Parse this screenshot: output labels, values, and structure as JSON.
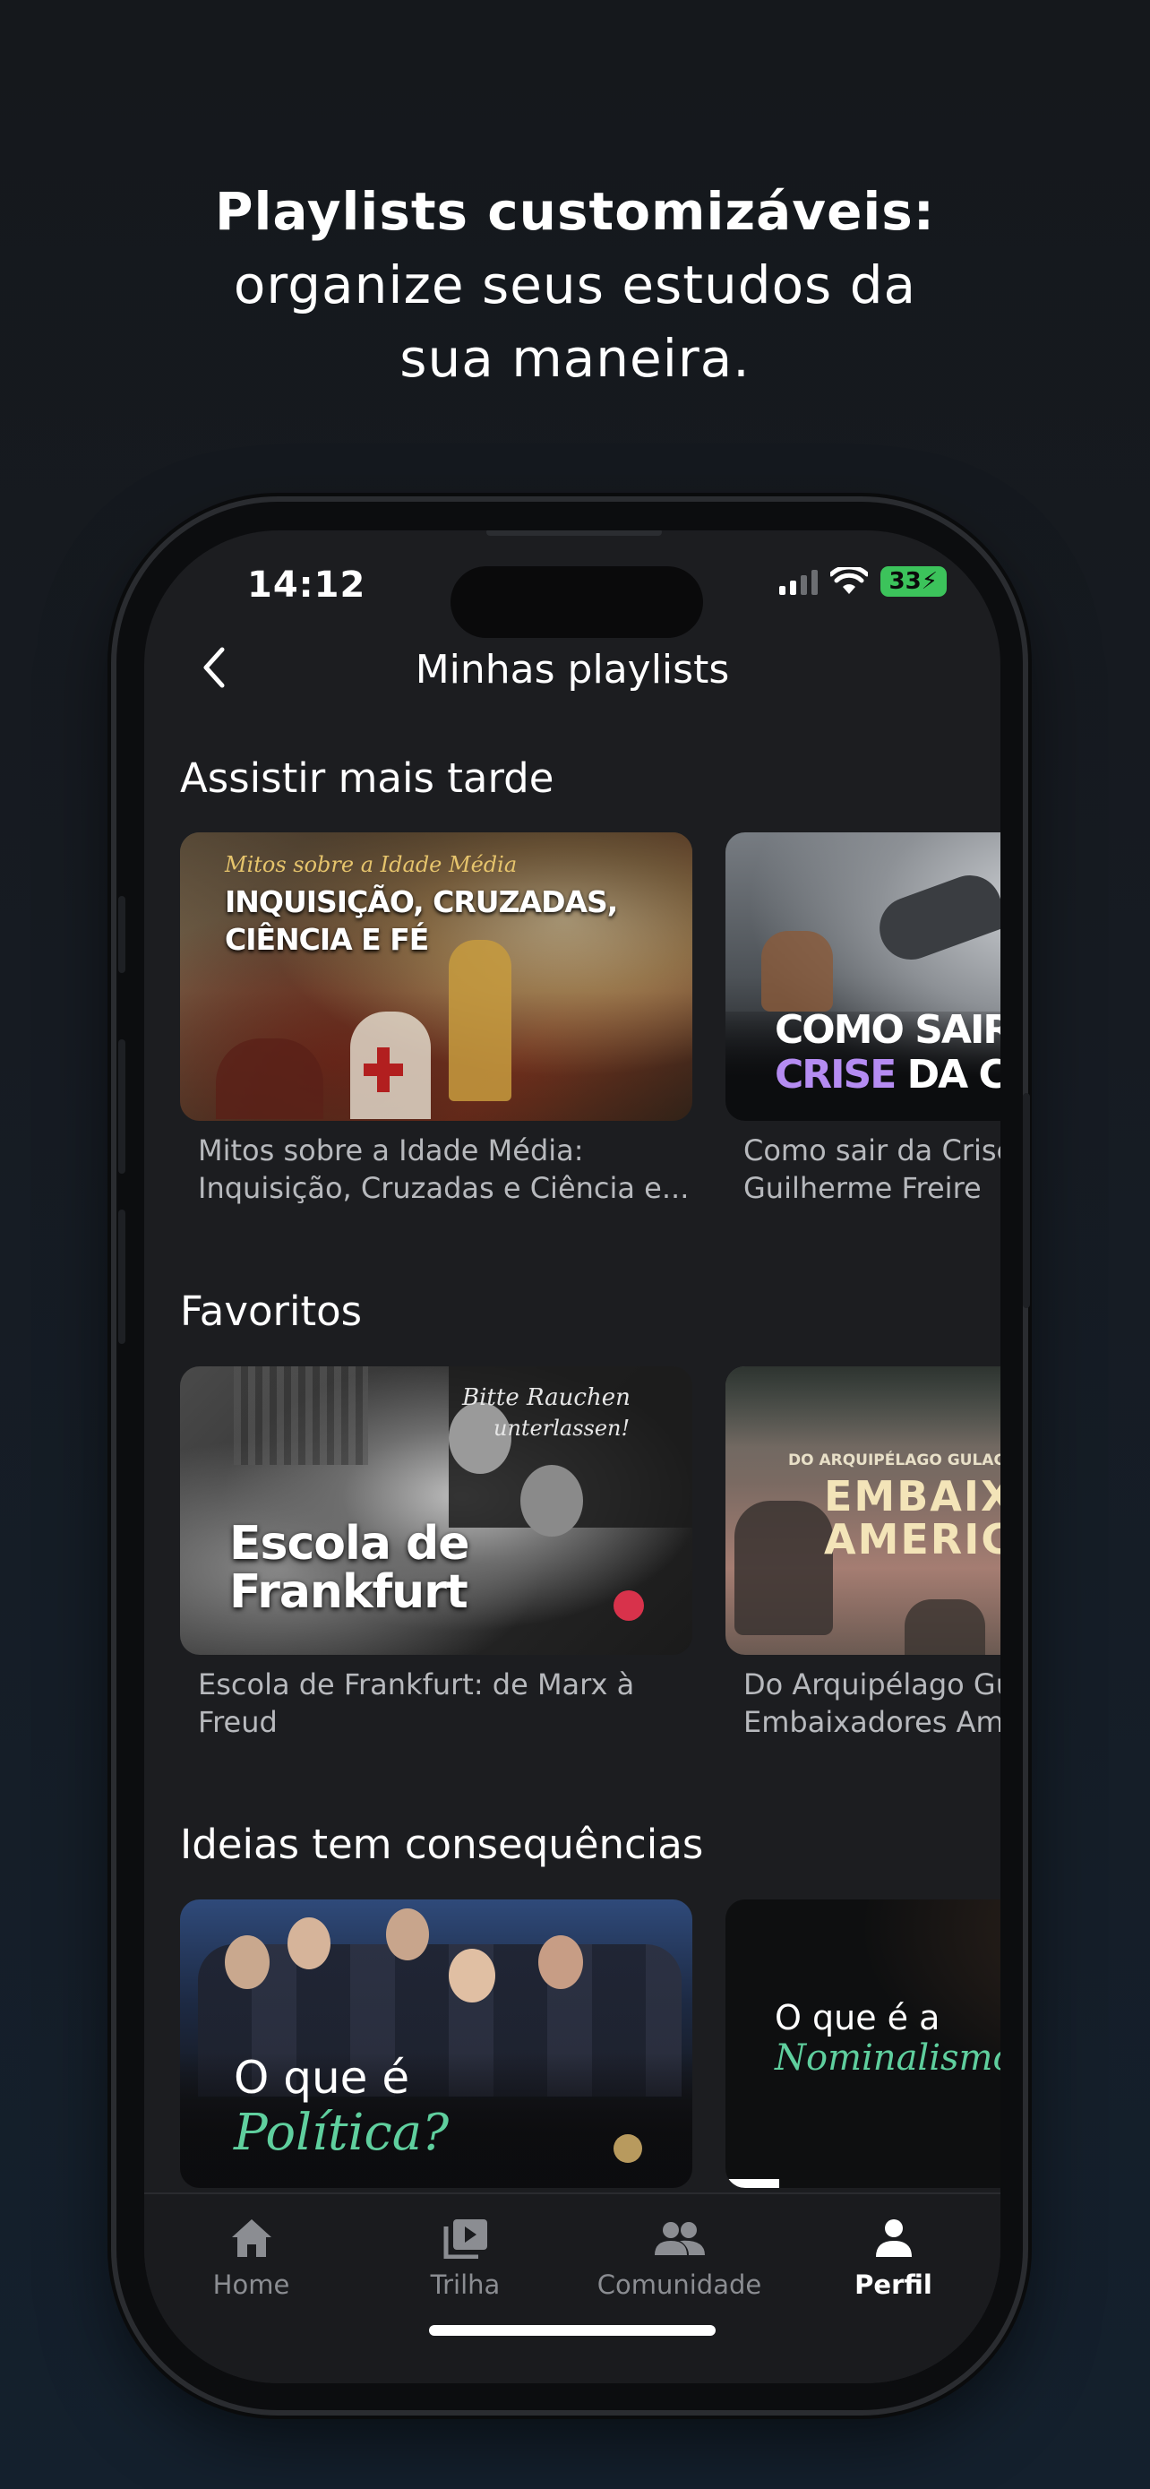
{
  "headline": {
    "bold": "Playlists customizáveis:",
    "line2": "organize seus estudos da",
    "line3": "sua maneira."
  },
  "status_bar": {
    "time": "14:12",
    "battery": "33"
  },
  "header": {
    "title": "Minhas playlists"
  },
  "sections": [
    {
      "title": "Assistir mais tarde",
      "cards": [
        {
          "thumb_kicker": "Mitos sobre a Idade Média",
          "thumb_title_1": "INQUISIÇÃO, CRUZADAS,",
          "thumb_title_2": "CIÊNCIA E FÉ",
          "caption_1": "Mitos sobre a Idade Média:",
          "caption_2": "Inquisição, Cruzadas e Ciência e..."
        },
        {
          "thumb_title_1": "COMO SAIR DA",
          "thumb_title_2a": "CRISE",
          "thumb_title_2b": " DA CULT",
          "caption_1": "Como sair da Crise",
          "caption_2": "Guilherme Freire"
        }
      ]
    },
    {
      "title": "Favoritos",
      "cards": [
        {
          "thumb_sign_1": "Bitte Rauchen",
          "thumb_sign_2": "unterlassen!",
          "thumb_title_1": "Escola de",
          "thumb_title_2": "Frankfurt",
          "caption_1": "Escola de Frankfurt: de Marx à",
          "caption_2": "Freud"
        },
        {
          "thumb_kicker": "DO ARQUIPÉLAGO GULAG AO",
          "thumb_title_1": "EMBAIXA",
          "thumb_title_2": "AMERICA",
          "caption_1": "Do Arquipélago Gu",
          "caption_2": "Embaixadores Am"
        }
      ]
    },
    {
      "title": "Ideias tem consequências",
      "cards": [
        {
          "thumb_title_1": "O que é",
          "thumb_title_2": "Política?"
        },
        {
          "thumb_title_1": "O que é a",
          "thumb_title_2": "Nominalismo"
        }
      ]
    }
  ],
  "tabs": [
    {
      "label": "Home",
      "icon": "home-icon"
    },
    {
      "label": "Trilha",
      "icon": "play-library-icon"
    },
    {
      "label": "Comunidade",
      "icon": "people-icon"
    },
    {
      "label": "Perfil",
      "icon": "person-icon",
      "active": true
    }
  ],
  "colors": {
    "accent_green": "#5fcf9e",
    "accent_purple": "#b58cf2",
    "battery_green": "#3cc35b"
  }
}
